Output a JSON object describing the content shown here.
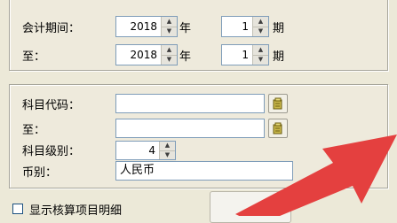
{
  "period": {
    "label": "会计期间：",
    "year_value": "2018",
    "year_unit": "年",
    "period_value": "1",
    "period_unit": "期"
  },
  "to_period": {
    "label": "至：",
    "year_value": "2018",
    "year_unit": "年",
    "period_value": "1",
    "period_unit": "期"
  },
  "filters": {
    "account_code_label": "科目代码：",
    "account_code_value": "",
    "to_label": "至：",
    "to_value": "",
    "level_label": "科目级别：",
    "level_value": "4",
    "currency_label": "币别：",
    "currency_value": "人民币"
  },
  "options": {
    "show_detail_label": "显示核算项目明细",
    "show_detail_checked": false
  },
  "colors": {
    "arrow": "#e4403f"
  }
}
